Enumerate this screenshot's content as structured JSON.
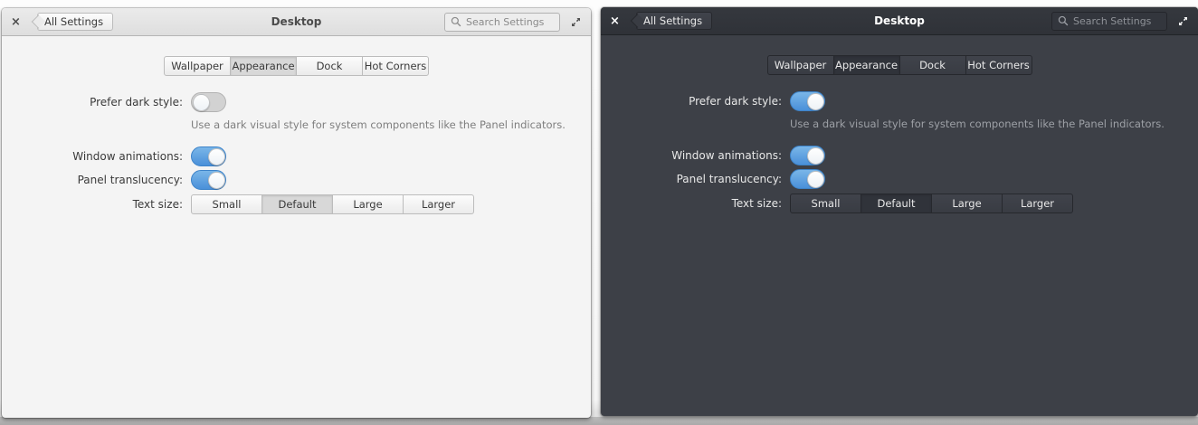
{
  "app": {
    "close_glyph": "×",
    "back_button_label": "All Settings",
    "title": "Desktop",
    "search": {
      "placeholder": "Search Settings"
    },
    "icons": {
      "close": "window-close",
      "search": "magnifier",
      "expand": "diagonal-resize-arrows",
      "back": "left-pointing-button"
    },
    "tabs": [
      "Wallpaper",
      "Appearance",
      "Dock",
      "Hot Corners"
    ],
    "active_tab": "Appearance",
    "rows": {
      "prefer_dark": {
        "label": "Prefer dark style:",
        "description": "Use a dark visual style for system components like the Panel indicators."
      },
      "window_animations": {
        "label": "Window animations:"
      },
      "panel_translucency": {
        "label": "Panel translucency:"
      },
      "text_size": {
        "label": "Text size:",
        "options": [
          "Small",
          "Default",
          "Large",
          "Larger"
        ],
        "selected": "Default"
      }
    }
  },
  "windows": [
    {
      "theme": "light",
      "prefer_dark_style": "off",
      "window_animations": "on",
      "panel_translucency": "on",
      "text_size": "Default"
    },
    {
      "theme": "dark",
      "prefer_dark_style": "on",
      "window_animations": "on",
      "panel_translucency": "on",
      "text_size": "Default"
    }
  ],
  "colors": {
    "accent_blue": "#4a90d9",
    "accent_blue_light": "#7ab6e8",
    "light_window_bg": "#f4f4f4",
    "light_header": "#e4e4e4",
    "dark_window_bg": "#3d4047",
    "dark_header": "#32353b"
  }
}
